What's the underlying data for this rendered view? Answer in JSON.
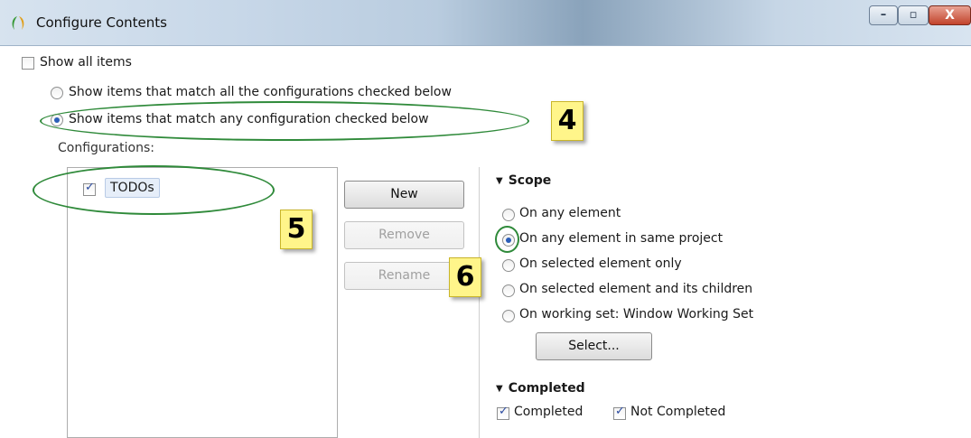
{
  "window": {
    "title": "Configure Contents",
    "controls": {
      "minimize": "–",
      "maximize": "▫",
      "close": "X"
    }
  },
  "options": {
    "show_all_items": {
      "label": "Show all items",
      "checked": false
    },
    "match_all": {
      "label": "Show items that match all the configurations checked below",
      "selected": false
    },
    "match_any": {
      "label": "Show items that match any configuration checked below",
      "selected": true
    }
  },
  "configurations": {
    "label": "Configurations:",
    "items": [
      {
        "label": "TODOs",
        "checked": true
      }
    ]
  },
  "buttons": {
    "new": "New",
    "remove": "Remove",
    "rename": "Rename",
    "select": "Select..."
  },
  "scope": {
    "title": "Scope",
    "options": [
      {
        "label": "On any element",
        "selected": false
      },
      {
        "label": "On any element in same project",
        "selected": true
      },
      {
        "label": "On selected element only",
        "selected": false
      },
      {
        "label": "On selected element and its children",
        "selected": false
      },
      {
        "label": "On working set:  Window Working Set",
        "selected": false
      }
    ]
  },
  "completed": {
    "title": "Completed",
    "completed_label": "Completed",
    "not_completed_label": "Not Completed"
  },
  "callouts": {
    "c4": "4",
    "c5": "5",
    "c6": "6"
  },
  "colors": {
    "annotation_green": "#2f8a3a",
    "callout_yellow": "#fff58a",
    "selection": "#2b5eb8"
  }
}
